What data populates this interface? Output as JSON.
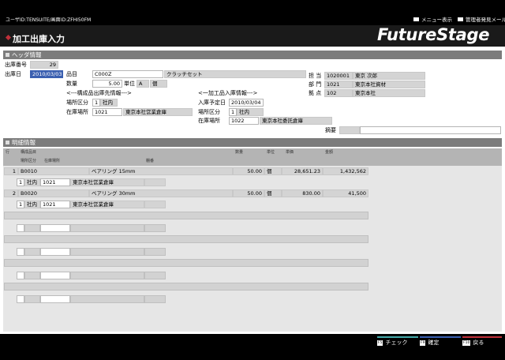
{
  "header_bar": {
    "user_info": "ユーザID:TENSUITE/画面ID:ZFHI50FM",
    "menu_label": "メニュー表示",
    "admin_label": "管理者発見メール"
  },
  "title": "加工出庫入力",
  "logo": "FutureStage",
  "header_section": {
    "title": "ヘッダ情報",
    "shipment_no_label": "出庫番号",
    "shipment_no": "29",
    "date_label": "出庫日",
    "date": "2010/03/03",
    "item_label": "品目",
    "item_code": "C000Z",
    "item_name": "クラッチセット",
    "qty_label": "数量",
    "qty": "5.00",
    "unit_label": "単位",
    "unit_code": "A",
    "unit_name": "個",
    "component_caption": "<---構成品出庫先情報--->",
    "loc_class_label": "場所区分",
    "loc_class_code": "1",
    "loc_class_name": "社内",
    "warehouse_label": "在庫場所",
    "warehouse_code": "1021",
    "warehouse_name": "東京本社営業倉庫",
    "processed_caption": "<一加工品入庫情報--->",
    "planned_date_label": "入庫予定日",
    "planned_date": "2010/03/04",
    "proc_loc_class_label": "場所区分",
    "proc_loc_class_code": "1",
    "proc_loc_class_name": "社内",
    "proc_warehouse_label": "在庫場所",
    "proc_warehouse_code": "1022",
    "proc_warehouse_name": "東京本社委託倉庫",
    "person_label": "担 当",
    "person_code": "1020001",
    "person_name": "東京 次郎",
    "dept_label": "部 門",
    "dept_code": "1021",
    "dept_name": "東京本社資材",
    "site_label": "拠 点",
    "site_code": "102",
    "site_name": "東京本社",
    "remarks_label": "摘要",
    "remarks": ""
  },
  "detail_section": {
    "title": "明細情報",
    "columns": {
      "row": "行",
      "component": "構成品目",
      "qty": "数量",
      "unit": "単位",
      "price": "単価",
      "amount": "金額",
      "loc_class": "場所区分",
      "warehouse": "在庫場所",
      "shelf": "棚番"
    },
    "rows": [
      {
        "no": "1",
        "code": "B0010",
        "name": "ベアリング 15mm",
        "qty": "50.00",
        "unit": "個",
        "price": "28,651.23",
        "amount": "1,432,562",
        "loc_code": "1",
        "loc_name": "社内",
        "wh_code": "1021",
        "wh_name": "東京本社営業倉庫"
      },
      {
        "no": "2",
        "code": "B0020",
        "name": "ベアリング 30mm",
        "qty": "50.00",
        "unit": "個",
        "price": "830.00",
        "amount": "41,500",
        "loc_code": "1",
        "loc_name": "社内",
        "wh_code": "1021",
        "wh_name": "東京本社営業倉庫"
      }
    ]
  },
  "footer": {
    "check_key": "F5",
    "check_label": "チェック",
    "confirm_key": "F9",
    "confirm_label": "確定",
    "back_key": "F10",
    "back_label": "戻る"
  }
}
